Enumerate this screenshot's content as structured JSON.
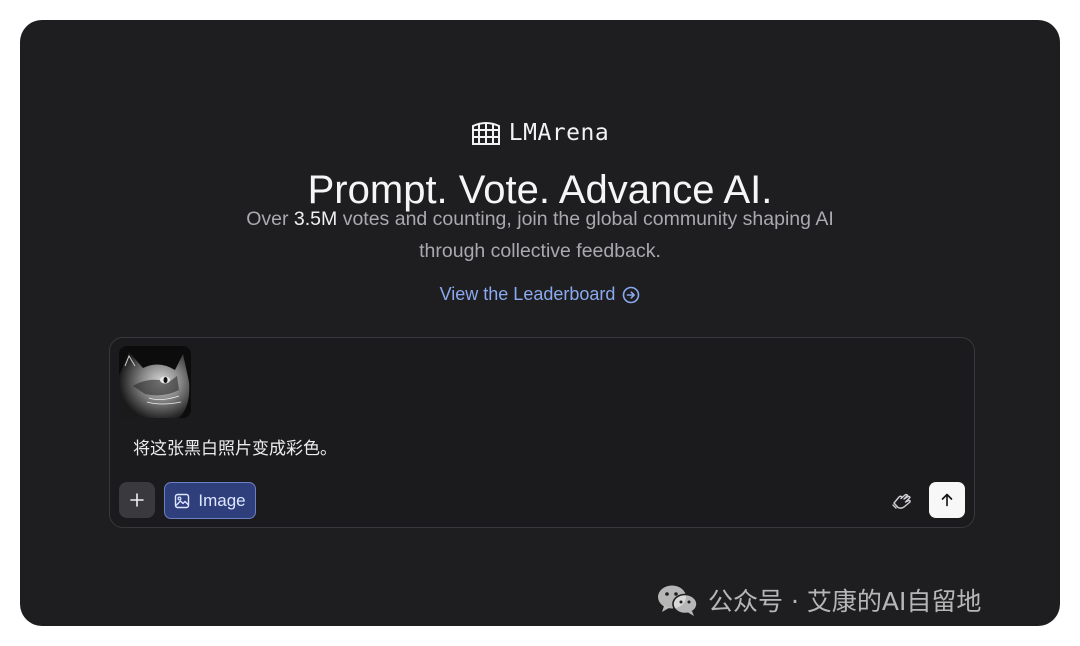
{
  "brand": {
    "logo_icon": "colosseum-icon",
    "name": "LMArena"
  },
  "hero": {
    "headline": "Prompt. Vote. Advance AI.",
    "subtitle_prefix": "Over ",
    "subtitle_highlight": "3.5M",
    "subtitle_suffix": " votes and counting, join the global community shaping AI through collective feedback."
  },
  "leaderboard_link": {
    "label": "View the Leaderboard",
    "icon": "arrow-circle-right-icon"
  },
  "composer": {
    "attachment": {
      "type": "image",
      "description_icon": "cat-photo-thumbnail"
    },
    "prompt_text": "将这张黑白照片变成彩色。",
    "add_button_icon": "plus-icon",
    "image_mode_label": "Image",
    "image_mode_icon": "image-icon",
    "hand_icon": "hand-stop-icon",
    "send_icon": "arrow-up-icon"
  },
  "watermark": {
    "icon": "wechat-icon",
    "text": "公众号 · 艾康的AI自留地"
  },
  "colors": {
    "background": "#1e1e20",
    "link": "#8aa9ee",
    "image_button_bg": "#2e3f7c",
    "send_button_bg": "#f7f7f7"
  }
}
